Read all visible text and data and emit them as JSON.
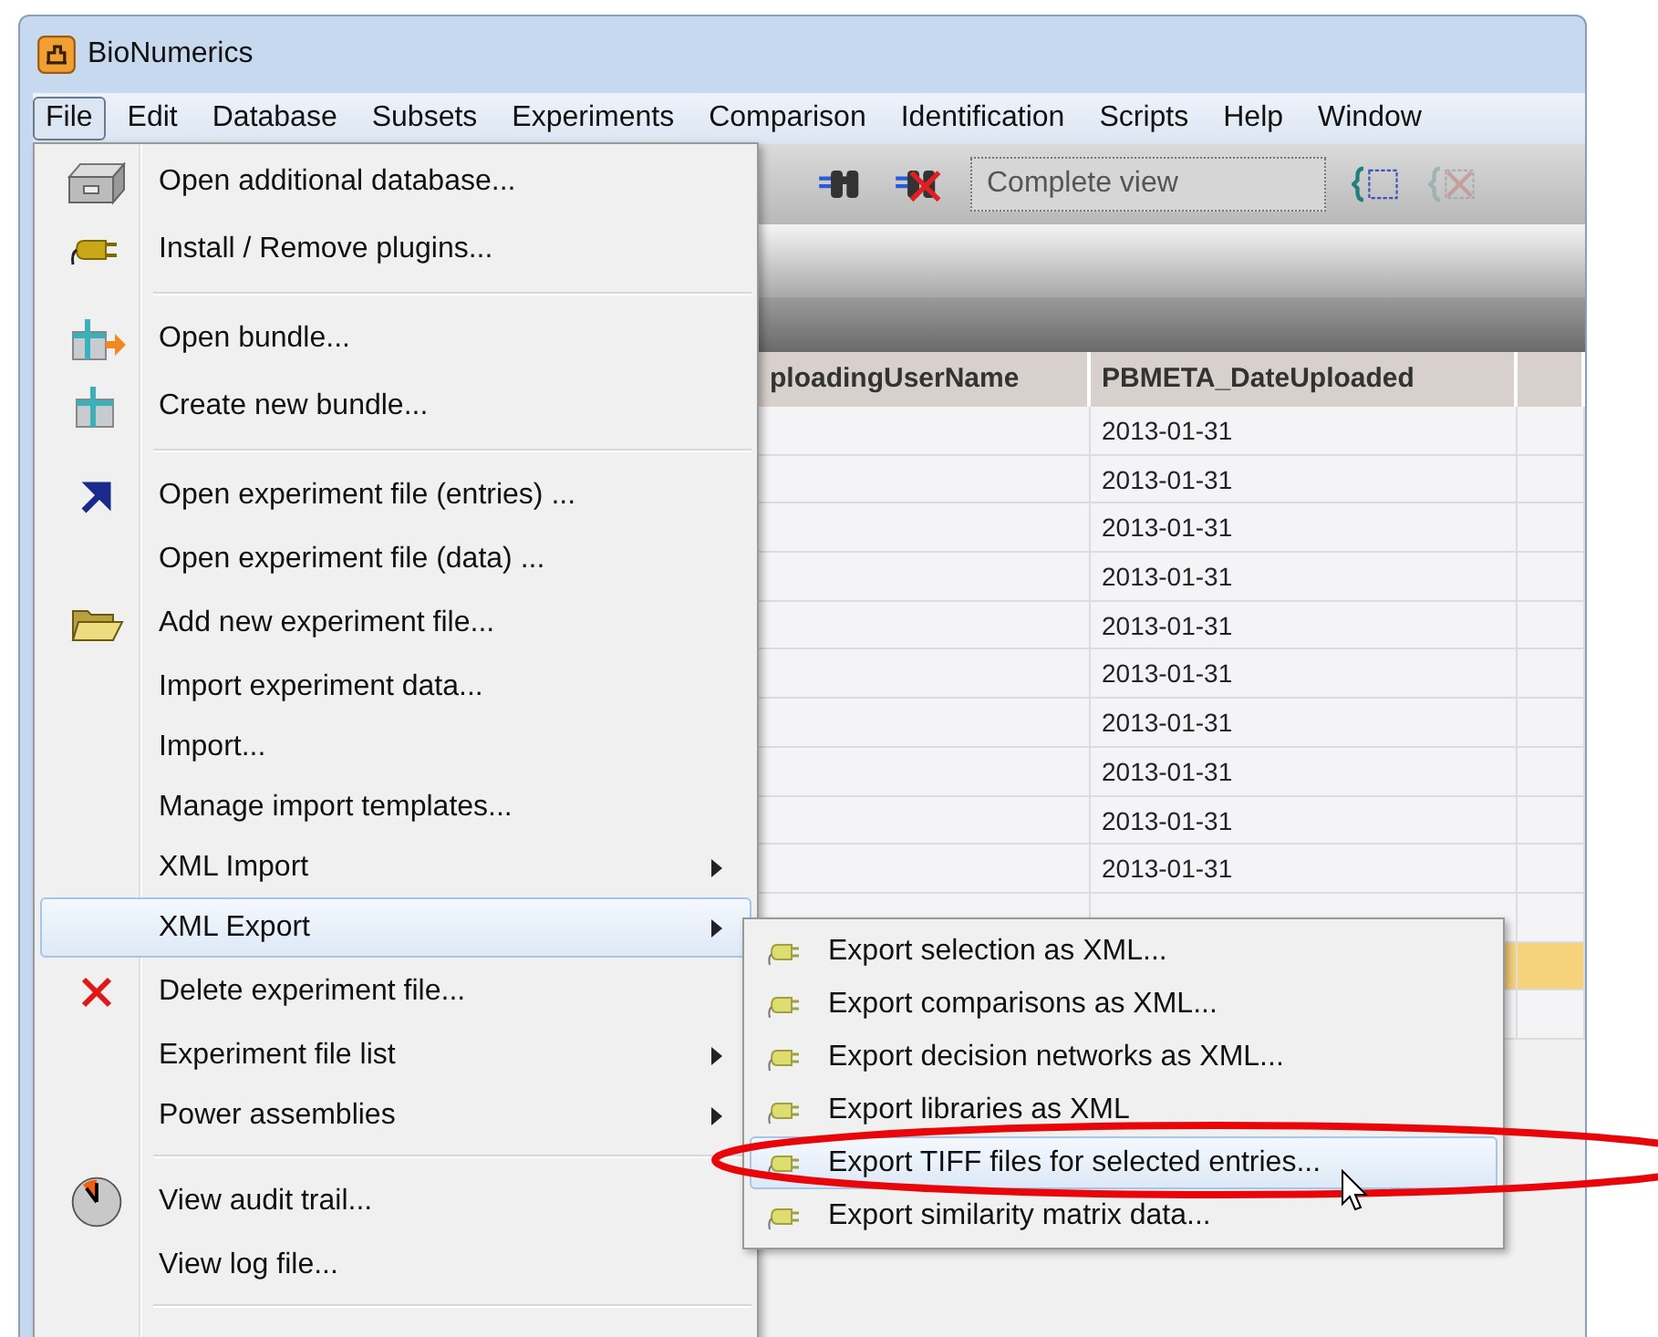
{
  "window": {
    "title": "BioNumerics"
  },
  "menu_bar": [
    {
      "label": "File",
      "selected": true
    },
    {
      "label": "Edit",
      "selected": false
    },
    {
      "label": "Database",
      "selected": false
    },
    {
      "label": "Subsets",
      "selected": false
    },
    {
      "label": "Experiments",
      "selected": false
    },
    {
      "label": "Comparison",
      "selected": false
    },
    {
      "label": "Identification",
      "selected": false
    },
    {
      "label": "Scripts",
      "selected": false
    },
    {
      "label": "Help",
      "selected": false
    },
    {
      "label": "Window",
      "selected": false
    }
  ],
  "toolbar": {
    "view_field": "Complete view"
  },
  "table": {
    "columns": [
      "ploadingUserName",
      "PBMETA_DateUploaded"
    ],
    "rows": [
      {
        "cells": [
          "",
          "2013-01-31"
        ],
        "selected": false
      },
      {
        "cells": [
          "",
          "2013-01-31"
        ],
        "selected": false
      },
      {
        "cells": [
          "",
          "2013-01-31"
        ],
        "selected": false
      },
      {
        "cells": [
          "",
          "2013-01-31"
        ],
        "selected": false
      },
      {
        "cells": [
          "",
          "2013-01-31"
        ],
        "selected": false
      },
      {
        "cells": [
          "",
          "2013-01-31"
        ],
        "selected": false
      },
      {
        "cells": [
          "",
          "2013-01-31"
        ],
        "selected": false
      },
      {
        "cells": [
          "",
          "2013-01-31"
        ],
        "selected": false
      },
      {
        "cells": [
          "",
          "2013-01-31"
        ],
        "selected": false
      },
      {
        "cells": [
          "",
          "2013-01-31"
        ],
        "selected": false
      },
      {
        "cells": [
          "",
          ""
        ],
        "selected": false
      },
      {
        "cells": [
          "",
          ""
        ],
        "selected": true
      },
      {
        "cells": [
          "",
          ""
        ],
        "selected": false
      }
    ]
  },
  "file_menu": {
    "items": [
      {
        "kind": "item",
        "label": "Open additional database...",
        "submenu": false,
        "selected": false
      },
      {
        "kind": "item",
        "label": "Install / Remove plugins...",
        "submenu": false,
        "selected": false
      },
      {
        "kind": "separator"
      },
      {
        "kind": "item",
        "label": "Open bundle...",
        "submenu": false,
        "selected": false
      },
      {
        "kind": "item",
        "label": "Create new bundle...",
        "submenu": false,
        "selected": false
      },
      {
        "kind": "separator"
      },
      {
        "kind": "item",
        "label": "Open experiment file (entries) ...",
        "submenu": false,
        "selected": false
      },
      {
        "kind": "item",
        "label": "Open experiment file (data) ...",
        "submenu": false,
        "selected": false
      },
      {
        "kind": "item",
        "label": "Add new experiment file...",
        "submenu": false,
        "selected": false
      },
      {
        "kind": "item",
        "label": "Import experiment data...",
        "submenu": false,
        "selected": false
      },
      {
        "kind": "item",
        "label": "Import...",
        "submenu": false,
        "selected": false
      },
      {
        "kind": "item",
        "label": "Manage import templates...",
        "submenu": false,
        "selected": false
      },
      {
        "kind": "item",
        "label": "XML Import",
        "submenu": true,
        "selected": false
      },
      {
        "kind": "item",
        "label": "XML Export",
        "submenu": true,
        "selected": true
      },
      {
        "kind": "item",
        "label": "Delete experiment file...",
        "submenu": false,
        "selected": false
      },
      {
        "kind": "item",
        "label": "Experiment file list",
        "submenu": true,
        "selected": false
      },
      {
        "kind": "item",
        "label": "Power assemblies",
        "submenu": true,
        "selected": false
      },
      {
        "kind": "separator"
      },
      {
        "kind": "item",
        "label": "View audit trail...",
        "submenu": false,
        "selected": false
      },
      {
        "kind": "item",
        "label": "View log file...",
        "submenu": false,
        "selected": false
      },
      {
        "kind": "separator"
      }
    ]
  },
  "xml_export_submenu": {
    "items": [
      {
        "label": "Export selection as XML...",
        "selected": false
      },
      {
        "label": "Export comparisons as XML...",
        "selected": false
      },
      {
        "label": "Export decision networks as XML...",
        "selected": false
      },
      {
        "label": "Export libraries as XML",
        "selected": false
      },
      {
        "label": "Export TIFF files for selected entries...",
        "selected": true
      },
      {
        "label": "Export similarity matrix data...",
        "selected": false
      }
    ]
  }
}
